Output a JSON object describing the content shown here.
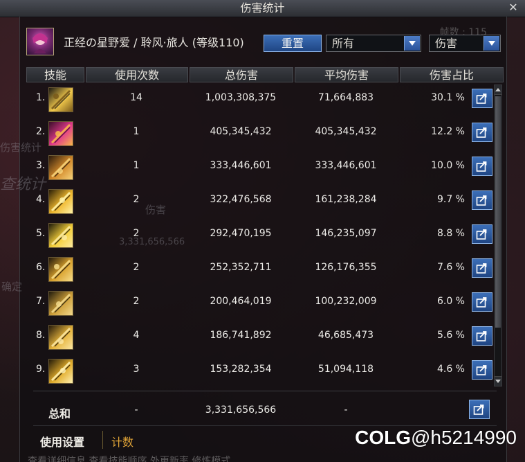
{
  "window": {
    "title": "伤害统计",
    "frame_count": "帧数 : 115"
  },
  "character": {
    "name": "正经の星野爱 / 聆风·旅人 (等级110)"
  },
  "controls": {
    "reset_label": "重置",
    "filter_select_value": "所有",
    "metric_select_value": "伤害"
  },
  "table": {
    "columns": [
      "技能",
      "使用次数",
      "总伤害",
      "平均伤害",
      "伤害占比"
    ],
    "rows": [
      {
        "rank": "1.",
        "uses": "14",
        "total": "1,003,308,375",
        "average": "71,664,883",
        "percent": "30.1 %",
        "icon": "skill-icon-1",
        "share_pct": 30.1
      },
      {
        "rank": "2.",
        "uses": "1",
        "total": "405,345,432",
        "average": "405,345,432",
        "percent": "12.2 %",
        "icon": "skill-icon-2",
        "share_pct": 12.2
      },
      {
        "rank": "3.",
        "uses": "1",
        "total": "333,446,601",
        "average": "333,446,601",
        "percent": "10.0 %",
        "icon": "skill-icon-3",
        "share_pct": 10.0
      },
      {
        "rank": "4.",
        "uses": "2",
        "total": "322,476,568",
        "average": "161,238,284",
        "percent": "9.7 %",
        "icon": "skill-icon-4",
        "share_pct": 9.7
      },
      {
        "rank": "5.",
        "uses": "2",
        "total": "292,470,195",
        "average": "146,235,097",
        "percent": "8.8 %",
        "icon": "skill-icon-5",
        "share_pct": 8.8
      },
      {
        "rank": "6.",
        "uses": "2",
        "total": "252,352,711",
        "average": "126,176,355",
        "percent": "7.6 %",
        "icon": "skill-icon-6",
        "share_pct": 7.6
      },
      {
        "rank": "7.",
        "uses": "2",
        "total": "200,464,019",
        "average": "100,232,009",
        "percent": "6.0 %",
        "icon": "skill-icon-7",
        "share_pct": 6.0
      },
      {
        "rank": "8.",
        "uses": "4",
        "total": "186,741,892",
        "average": "46,685,473",
        "percent": "5.6 %",
        "icon": "skill-icon-8",
        "share_pct": 5.6
      },
      {
        "rank": "9.",
        "uses": "3",
        "total": "153,282,354",
        "average": "51,094,118",
        "percent": "4.6 %",
        "icon": "skill-icon-9",
        "share_pct": 4.6
      }
    ]
  },
  "totals": {
    "label": "总和",
    "uses": "-",
    "total": "3,331,656,566",
    "average": "-"
  },
  "tabs": {
    "usage_label": "使用设置",
    "count_label": "计数"
  },
  "background_ghost": {
    "left_title": "伤害统计",
    "left_heading": "查统计",
    "left_button": "确定",
    "mid_label": "伤害",
    "mid_value": "3,331,656,566",
    "bottom_text": "查看详细信息    查看技能顺序    外更新率    修炼模式"
  },
  "watermark": {
    "logo": "COLG",
    "handle": "@h5214990"
  },
  "colors": {
    "accent_blue": "#2f5ea6",
    "count_tab_orange": "#e0a437",
    "text_light": "#ecebe7"
  }
}
